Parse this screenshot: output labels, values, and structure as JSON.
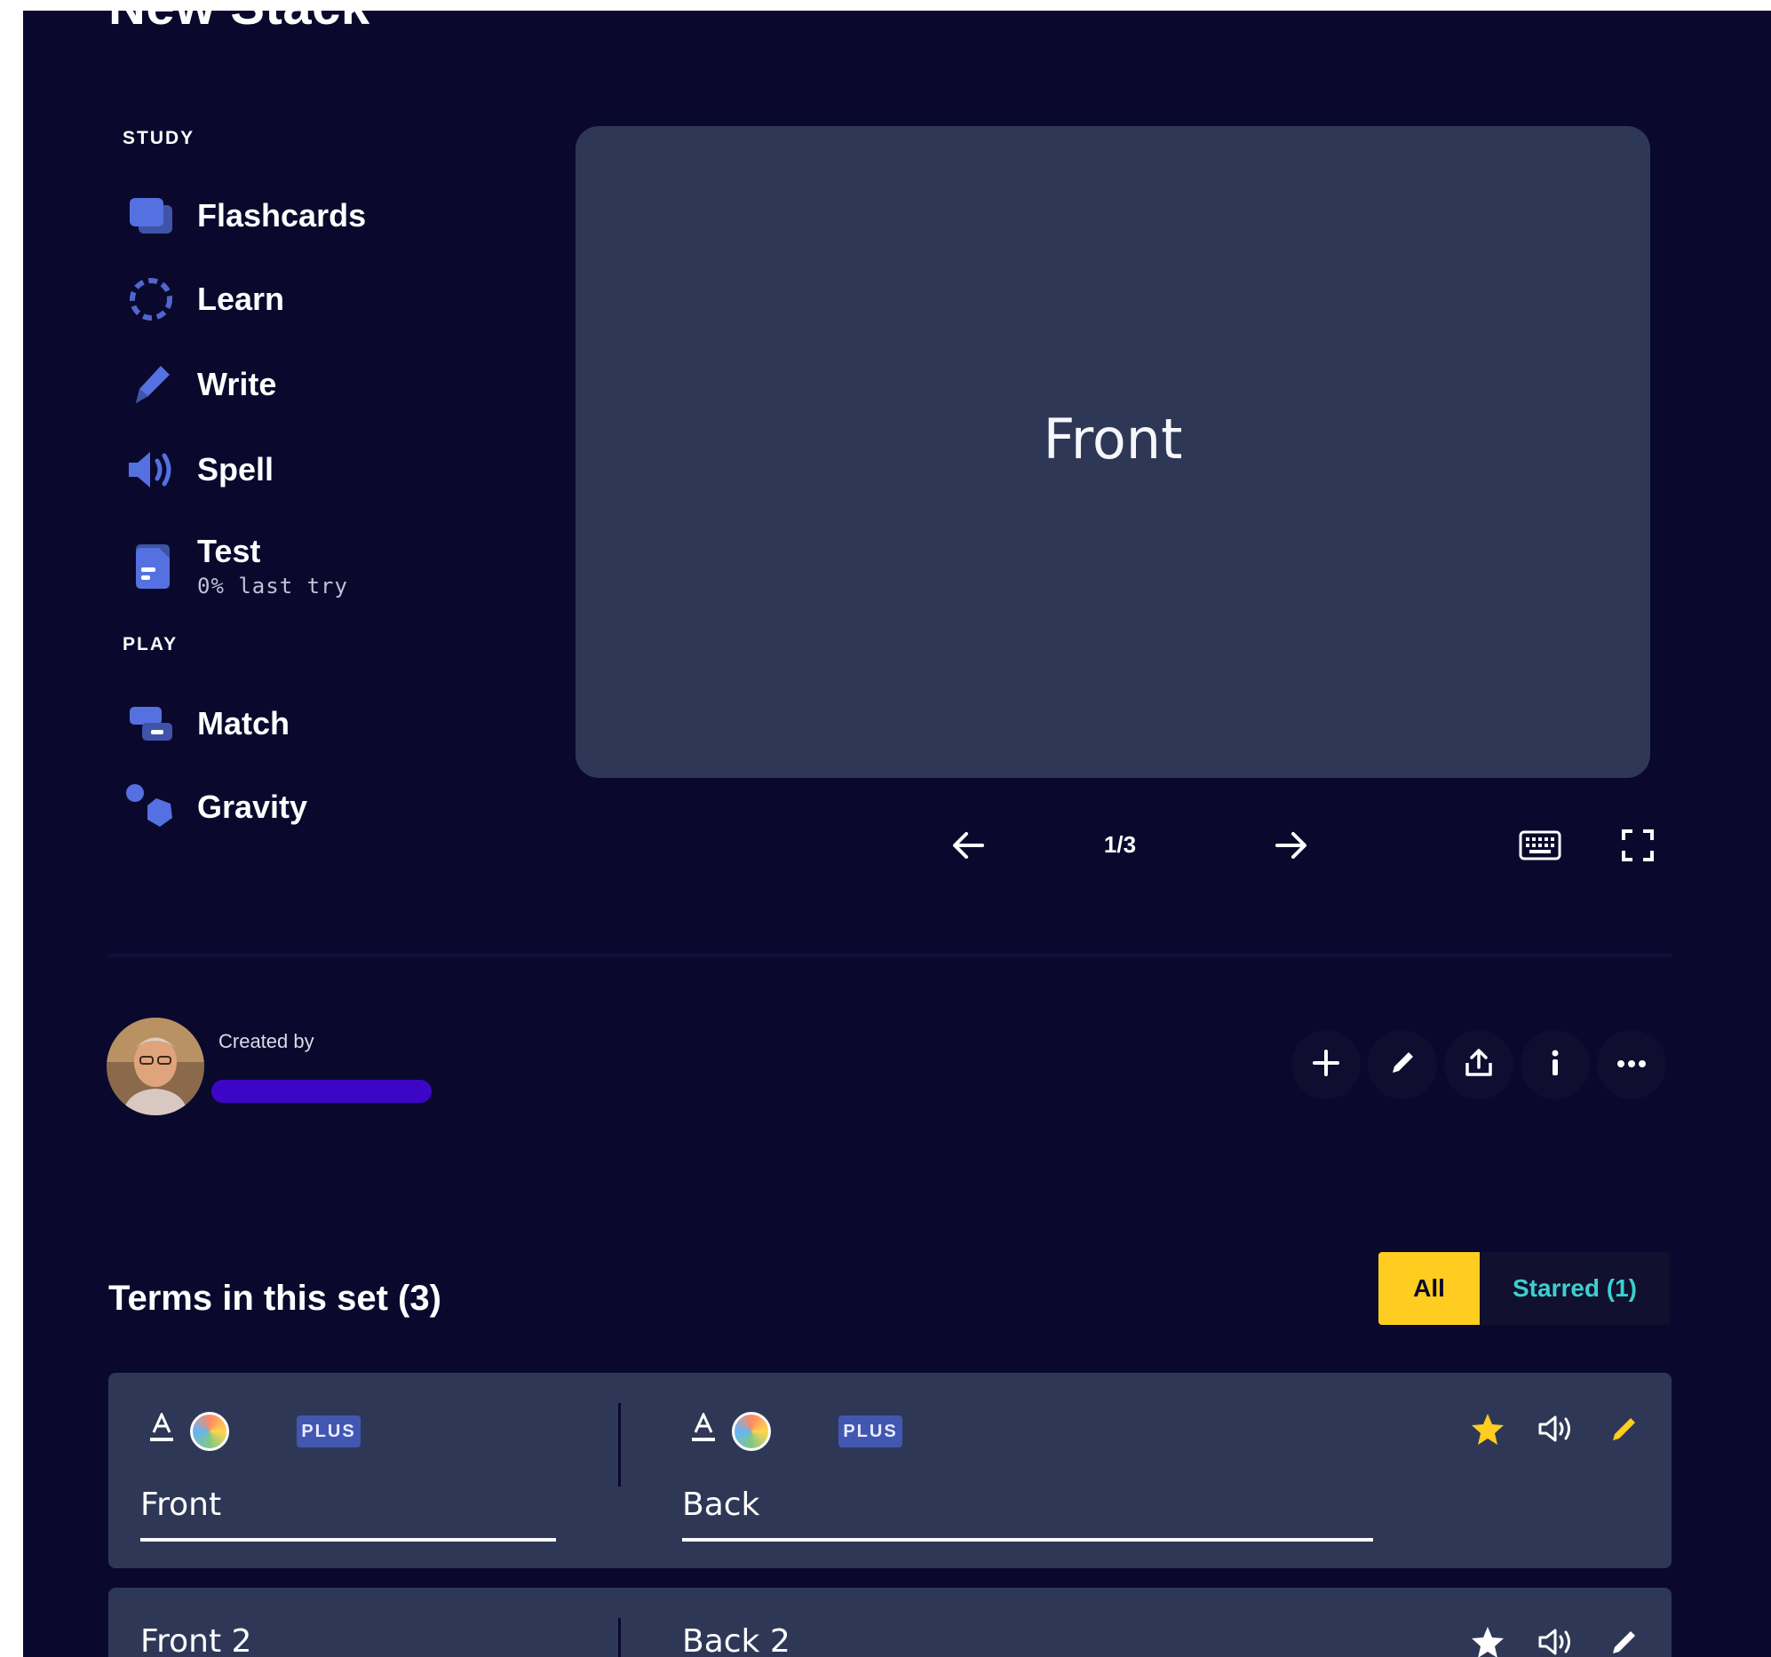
{
  "page": {
    "title": "New Stack"
  },
  "sidebar": {
    "study_label": "STUDY",
    "play_label": "PLAY",
    "study_items": [
      {
        "label": "Flashcards",
        "icon": "flashcards-icon"
      },
      {
        "label": "Learn",
        "icon": "learn-icon"
      },
      {
        "label": "Write",
        "icon": "write-icon"
      },
      {
        "label": "Spell",
        "icon": "spell-icon"
      },
      {
        "label": "Test",
        "sub": "0% last try",
        "icon": "test-icon"
      }
    ],
    "play_items": [
      {
        "label": "Match",
        "icon": "match-icon"
      },
      {
        "label": "Gravity",
        "icon": "gravity-icon"
      }
    ]
  },
  "flashcard": {
    "text": "Front",
    "counter": "1/3"
  },
  "creator": {
    "label": "Created by"
  },
  "terms": {
    "title": "Terms in this set (3)",
    "filter_all": "All",
    "filter_starred": "Starred (1)",
    "plus_label": "PLUS",
    "rows": [
      {
        "front": "Front",
        "back": "Back",
        "starred": true
      },
      {
        "front": "Front 2",
        "back": "Back 2",
        "starred": false
      }
    ]
  },
  "colors": {
    "background": "#0a092d",
    "card": "#2e3856",
    "accent_yellow": "#ffcd1f",
    "accent_teal": "#3ccfcf",
    "icon_blue": "#4257b2"
  }
}
